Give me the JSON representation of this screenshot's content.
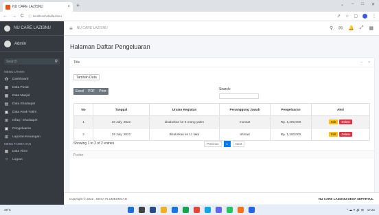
{
  "browser": {
    "tab_title": "NU CARE LAZISNU",
    "tab_close": "×",
    "new_tab": "+",
    "url": "localhost/vital/lazisnu",
    "nav_back": "←",
    "nav_forward": "→",
    "nav_reload": "C"
  },
  "sidebar": {
    "brand": "NU CARE LAZISNU",
    "user": "Admin",
    "search_placeholder": "Search",
    "section_main": "MENU UTAMA",
    "section_other": "MENU TAMBAHAN",
    "items": [
      {
        "icon": "dashboard-icon",
        "glyph": "✿",
        "label": "Dashboard"
      },
      {
        "icon": "table-icon",
        "glyph": "▦",
        "label": "Data Pusat"
      },
      {
        "icon": "table-icon",
        "glyph": "▦",
        "label": "Data Masjid"
      },
      {
        "icon": "list-icon",
        "glyph": "▤",
        "label": "Data Shadaqah"
      },
      {
        "icon": "box-icon",
        "glyph": "▣",
        "label": "Data Anak Yatim"
      },
      {
        "icon": "plus-box-icon",
        "glyph": "⊞",
        "label": "Infaq / Shodaqoh"
      },
      {
        "icon": "box-icon",
        "glyph": "▣",
        "label": "Pengeluaran"
      },
      {
        "icon": "plus-box-icon",
        "glyph": "⊞",
        "label": "Laporan Keuangan"
      }
    ],
    "extra_items": [
      {
        "icon": "table-icon",
        "glyph": "▦",
        "label": "Data Akun"
      },
      {
        "icon": "logout-icon",
        "glyph": "○",
        "label": "Logout"
      }
    ]
  },
  "topbar": {
    "menu": "≡",
    "crumb": "NU CARE LAZISNU"
  },
  "page": {
    "title": "Halaman Daftar Pengeluaran"
  },
  "card": {
    "header": "Title",
    "add_label": "Tambah Data",
    "export": [
      "Excel",
      "PDF",
      "Print"
    ],
    "search_label": "Search:",
    "columns": [
      "No",
      "Tanggal",
      "Uraian Kegiatan",
      "Penanggung Jawab",
      "Pengeluaran",
      "Aksi"
    ],
    "rows": [
      {
        "no": "1",
        "date": "28 July, 2022",
        "desc": "disalurkan ke 5 orang yatim",
        "pj": "munsat",
        "amount": "Rp. 1,200,000"
      },
      {
        "no": "2",
        "date": "29 July, 2022",
        "desc": "disalurkan ke 11 fakir",
        "pj": "ahmad",
        "amount": "Rp. 1,200,000"
      }
    ],
    "edit_label": "Edit",
    "delete_label": "Delete",
    "info": "Showing 1 to 2 of 2 entries",
    "prev": "Previous",
    "current_page": "1",
    "next": "Next",
    "footer": "Footer"
  },
  "footer": {
    "copyright": "Copyright © 2022 . DESA PLUMBUNGAN",
    "right": "NU CARE LAZISNU DESA SEPARYUL"
  },
  "taskbar": {
    "weather": "29°C",
    "tray": "^ ☁ ✈ 🔊 ⊞",
    "time": "17:22"
  }
}
